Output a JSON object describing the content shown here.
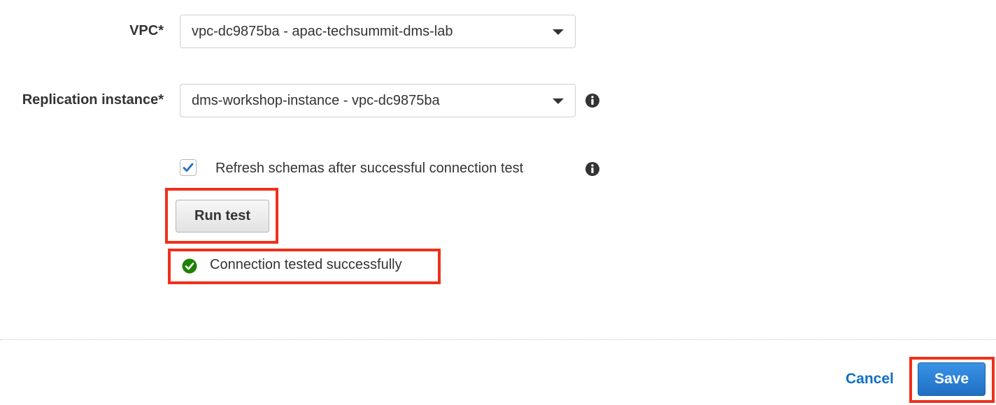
{
  "form": {
    "vpc": {
      "label": "VPC*",
      "value": "vpc-dc9875ba - apac-techsummit-dms-lab"
    },
    "replication_instance": {
      "label": "Replication instance*",
      "value": "dms-workshop-instance - vpc-dc9875ba"
    },
    "refresh_schemas": {
      "label": "Refresh schemas after successful connection test",
      "checked": true
    }
  },
  "actions": {
    "run_test_label": "Run test",
    "status_text": "Connection tested successfully",
    "cancel_label": "Cancel",
    "save_label": "Save"
  },
  "icons": {
    "dropdown": "caret-down-icon",
    "info": "info-icon",
    "check": "checkmark-icon",
    "success": "check-circle-icon"
  },
  "colors": {
    "highlight": "#f0301a",
    "primary": "#1f6fc4",
    "link": "#0f6fc6",
    "success": "#1d8102",
    "checkbox_check": "#1f6fc4"
  }
}
